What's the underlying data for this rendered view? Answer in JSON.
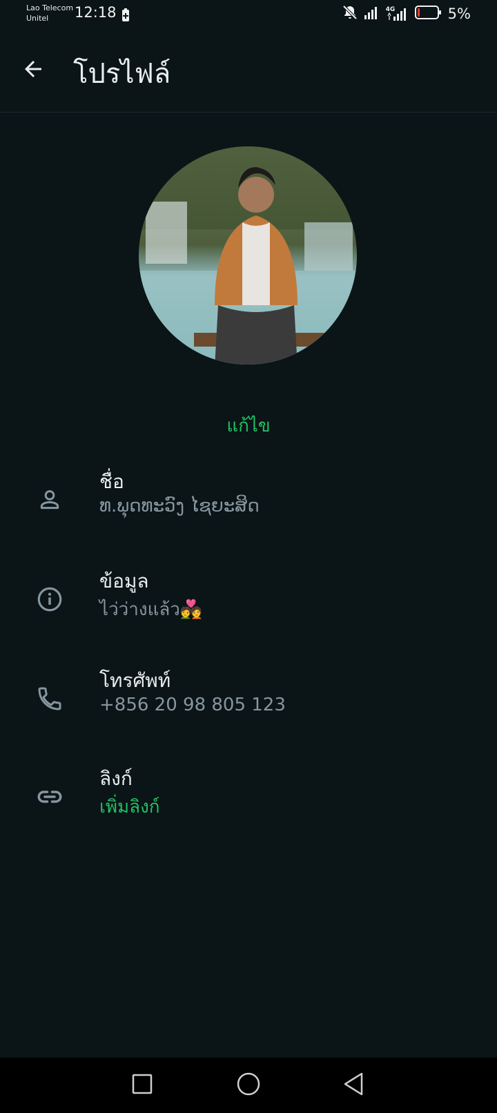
{
  "status_bar": {
    "carrier_1": "Lao Telecom",
    "carrier_2": "Unitel",
    "time": "12:18",
    "battery_percent": "5%",
    "network_label": "4G",
    "icons": [
      "battery-saver-icon",
      "notifications-off-icon",
      "signal-icon",
      "signal-4g-icon",
      "battery-icon"
    ]
  },
  "app_bar": {
    "title": "โปรไฟล์",
    "back_icon": "arrow-left-icon"
  },
  "profile": {
    "edit_label": "แก้ไข"
  },
  "fields": [
    {
      "icon": "person-icon",
      "label": "ชื่อ",
      "value": "ທ.ພຸດທະວົງ ໄຊຍະສິດ"
    },
    {
      "icon": "info-icon",
      "label": "ข้อมูล",
      "value": "ไว่ว่างแล้ว💑"
    },
    {
      "icon": "phone-icon",
      "label": "โทรศัพท์",
      "value": "+856 20 98 805 123"
    },
    {
      "icon": "link-icon",
      "label": "ลิงก์",
      "value": "เพิ่มลิงก์"
    }
  ],
  "colors": {
    "background": "#0b1416",
    "accent": "#21c063",
    "secondary_text": "#8696a0",
    "primary_text": "#e9edef"
  },
  "nav_bar": {
    "icons": [
      "recents-square-icon",
      "home-circle-icon",
      "back-triangle-icon"
    ]
  }
}
